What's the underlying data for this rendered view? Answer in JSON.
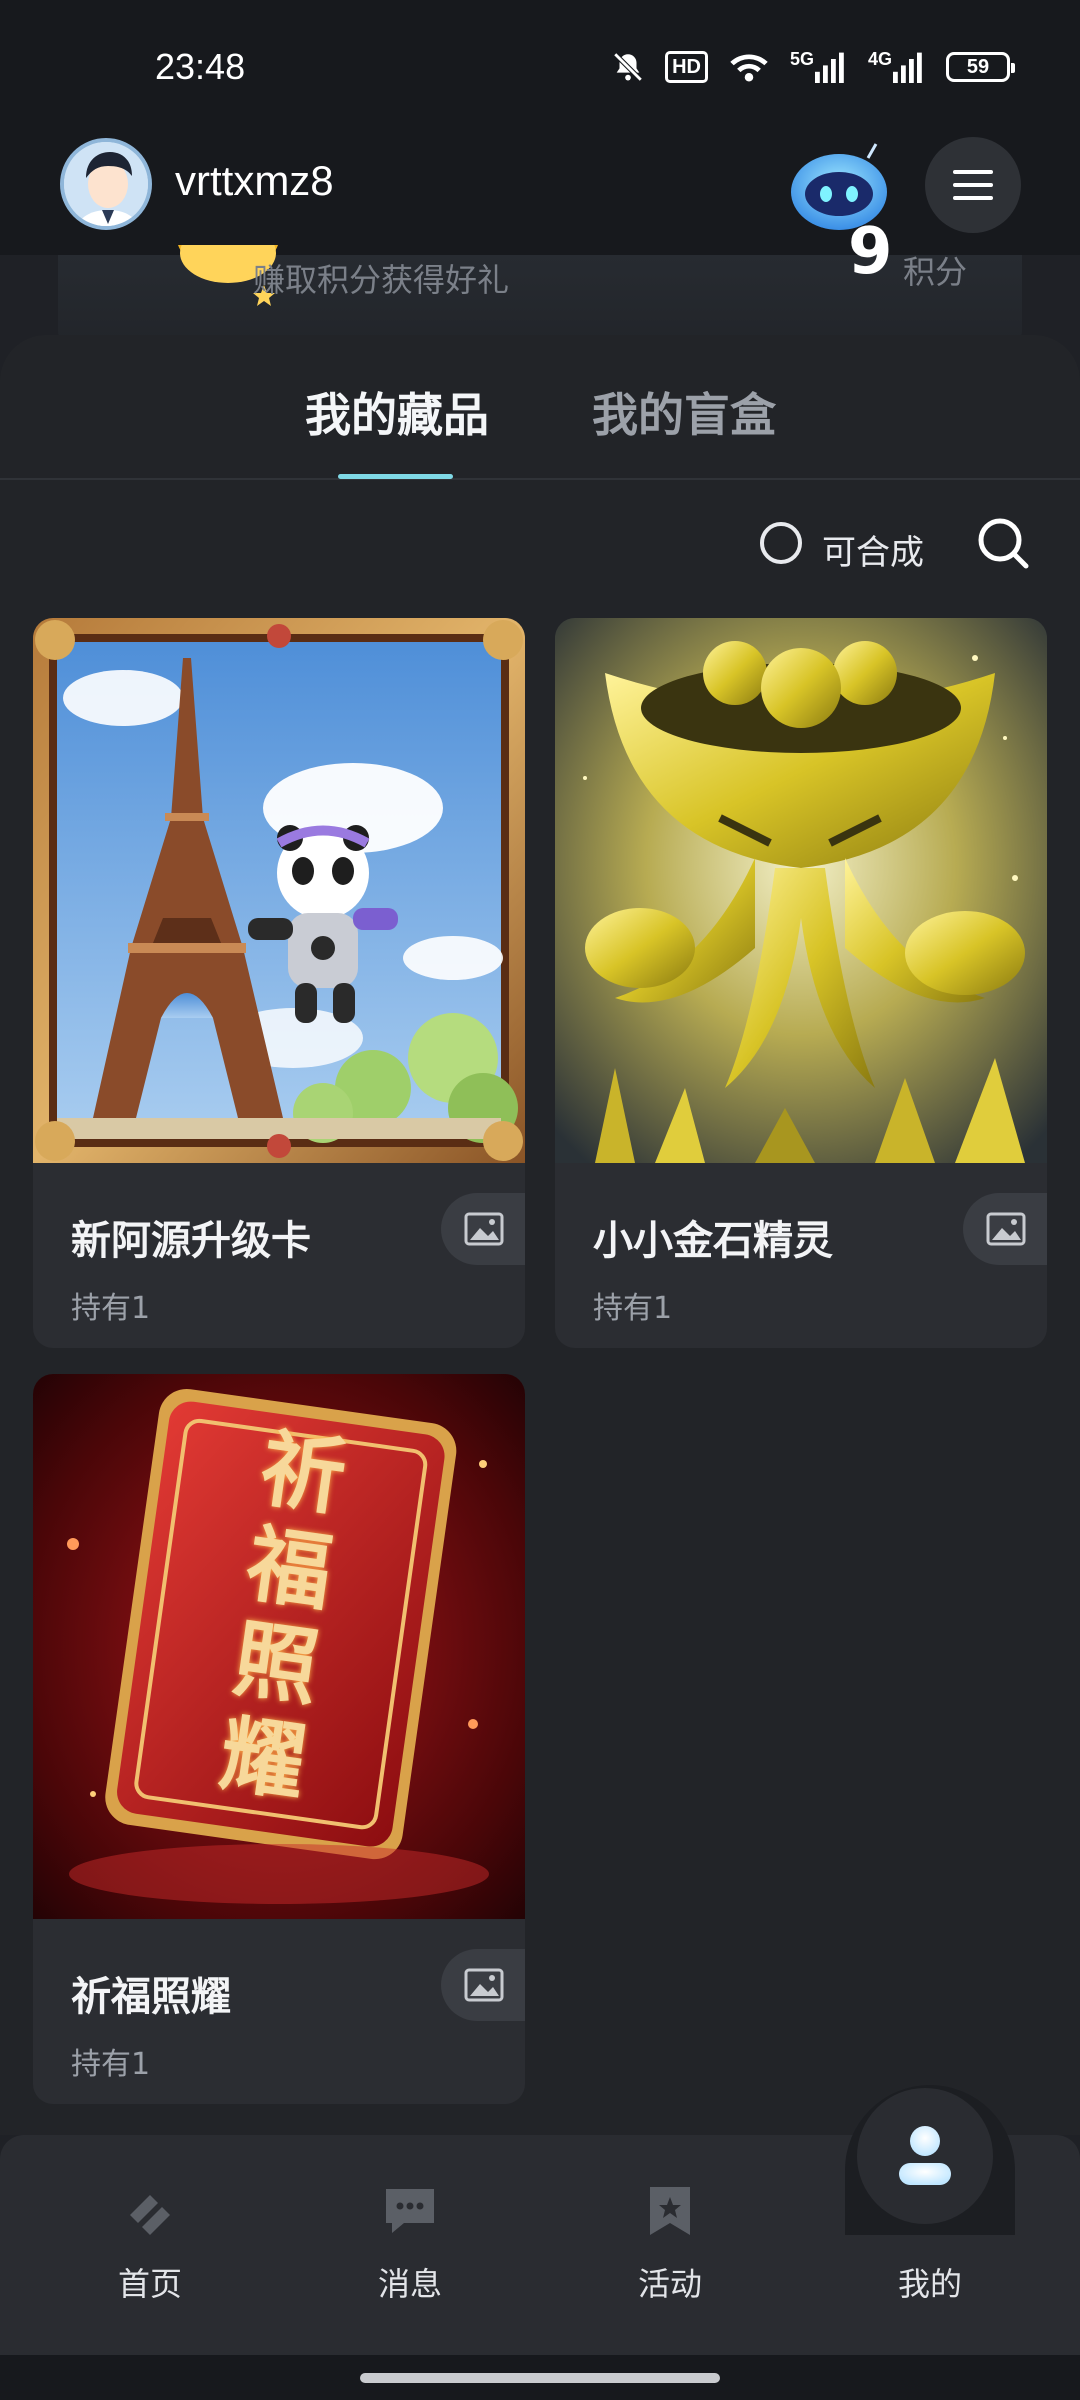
{
  "status_bar": {
    "time": "23:48",
    "hd_label": "HD",
    "net1": "5G",
    "net2": "4G",
    "battery": "59"
  },
  "header": {
    "username": "vrttxmz8"
  },
  "points_banner": {
    "subtitle": "赚取积分获得好礼",
    "points_value": "9",
    "points_unit": "积分"
  },
  "tabs": [
    {
      "label": "我的藏品",
      "active": true
    },
    {
      "label": "我的盲盒",
      "active": false
    }
  ],
  "filter": {
    "label": "可合成",
    "checked": false
  },
  "collections": [
    {
      "title": "新阿源升级卡",
      "held": "持有1",
      "image": "eiffel-tower-panda-astronaut"
    },
    {
      "title": "小小金石精灵",
      "held": "持有1",
      "image": "golden-creature"
    },
    {
      "title": "祈福照耀",
      "held": "持有1",
      "image": "red-card-blessing"
    }
  ],
  "card3_art_text": [
    "祈",
    "福",
    "照",
    "耀"
  ],
  "bottom_nav": [
    {
      "label": "首页",
      "icon": "home-icon"
    },
    {
      "label": "消息",
      "icon": "message-icon"
    },
    {
      "label": "活动",
      "icon": "bookmark-star-icon"
    },
    {
      "label": "我的",
      "icon": "user-icon",
      "active": true
    }
  ],
  "colors": {
    "background": "#1f2126",
    "accent": "#7fd9e6",
    "card": "#2b2d32"
  }
}
